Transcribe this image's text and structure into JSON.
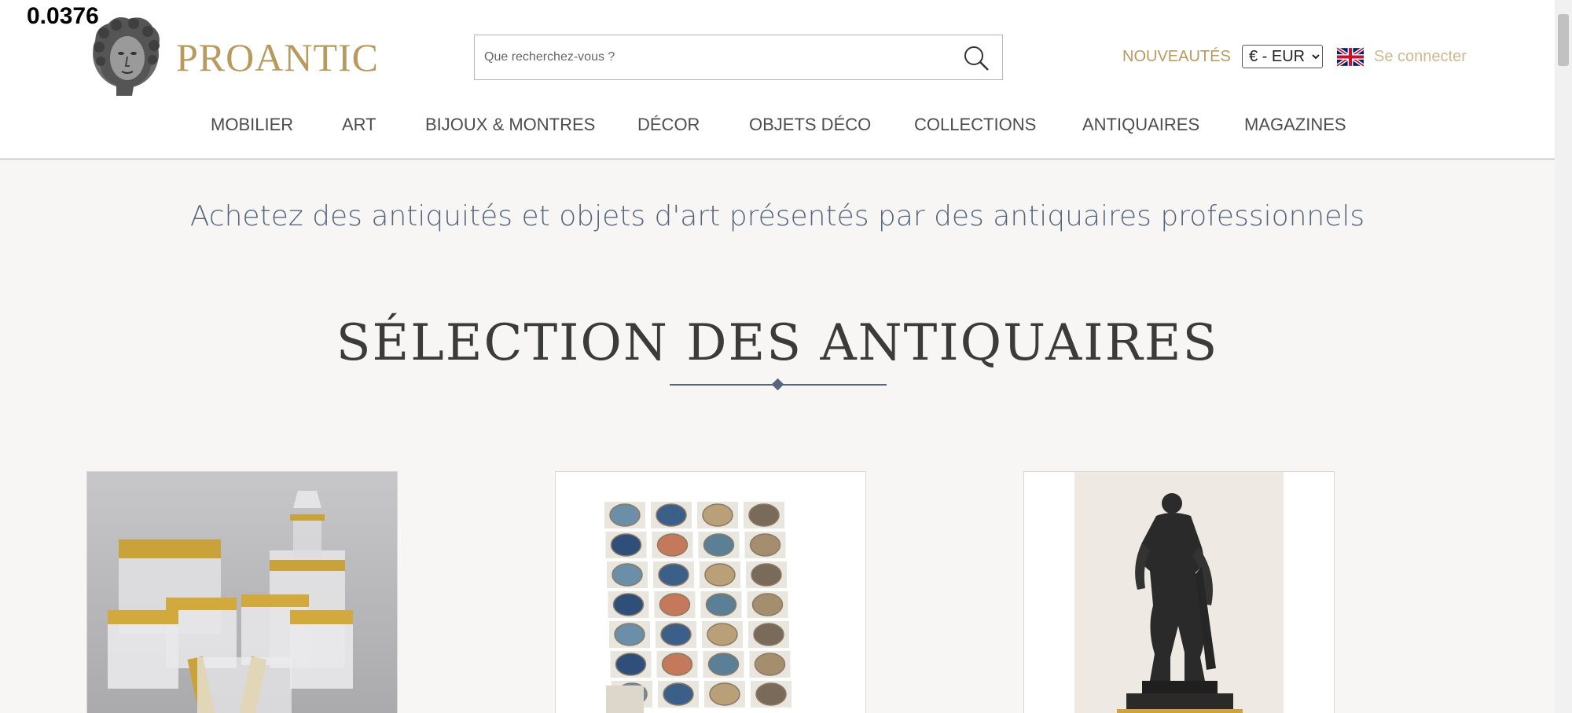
{
  "overlay": {
    "value": "0.0376"
  },
  "header": {
    "logo_text": "PROANTIC",
    "search": {
      "placeholder": "Que recherchez-vous ?",
      "value": ""
    },
    "new_label": "NOUVEAUTÉS",
    "currency": {
      "selected": "€ - EUR",
      "options": [
        "€ - EUR"
      ]
    },
    "language_flag": "uk-flag-icon",
    "login_label": "Se connecter"
  },
  "nav": {
    "items": [
      {
        "label": "MOBILIER"
      },
      {
        "label": "ART"
      },
      {
        "label": "BIJOUX & MONTRES"
      },
      {
        "label": "DÉCOR"
      },
      {
        "label": "OBJETS DÉCO"
      },
      {
        "label": "COLLECTIONS"
      },
      {
        "label": "ANTIQUAIRES"
      },
      {
        "label": "MAGAZINES"
      }
    ]
  },
  "main": {
    "tagline": "Achetez des antiquités et objets d'art présentés par des antiquaires professionnels",
    "section_title": "SÉLECTION DES ANTIQUAIRES",
    "cards": [
      {
        "image": "gilded-crystal-glassware-set"
      },
      {
        "image": "ceramic-plates-collection"
      },
      {
        "image": "bronze-hercules-statue"
      }
    ]
  },
  "colors": {
    "brand_gold": "#b89a5e",
    "nav_text": "#4d4d4d",
    "tagline": "#54677d",
    "background": "#f7f6f4"
  }
}
